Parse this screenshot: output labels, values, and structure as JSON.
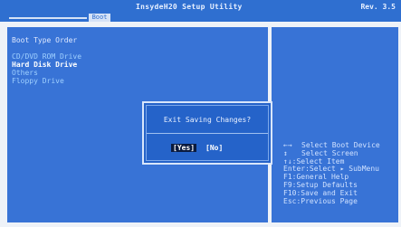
{
  "app": {
    "title": "InsydeH20 Setup Utility",
    "version": "Rev. 3.5"
  },
  "tab": {
    "label": "Boot"
  },
  "boot_list": {
    "heading": "Boot Type Order",
    "items": [
      {
        "label": "CD/DVD ROM Drive",
        "selected": false
      },
      {
        "label": "Hard Disk Drive",
        "selected": true
      },
      {
        "label": "Others",
        "selected": false
      },
      {
        "label": "Floppy Drive",
        "selected": false
      }
    ]
  },
  "dialog": {
    "title": "Exit Saving Changes?",
    "yes_label": "[Yes]",
    "no_label": "[No]"
  },
  "help": [
    {
      "key": "←→",
      "text": "Select Boot Device"
    },
    {
      "key": "↕",
      "text": "Select Screen"
    },
    {
      "key": "",
      "text": "↑↓:Select Item"
    },
    {
      "key": "",
      "text": "Enter:Select ▸ SubMenu"
    },
    {
      "key": "",
      "text": "F1:General Help"
    },
    {
      "key": "",
      "text": "F9:Setup Defaults"
    },
    {
      "key": "",
      "text": "F10:Save and Exit"
    },
    {
      "key": "",
      "text": "Esc:Previous Page"
    }
  ]
}
